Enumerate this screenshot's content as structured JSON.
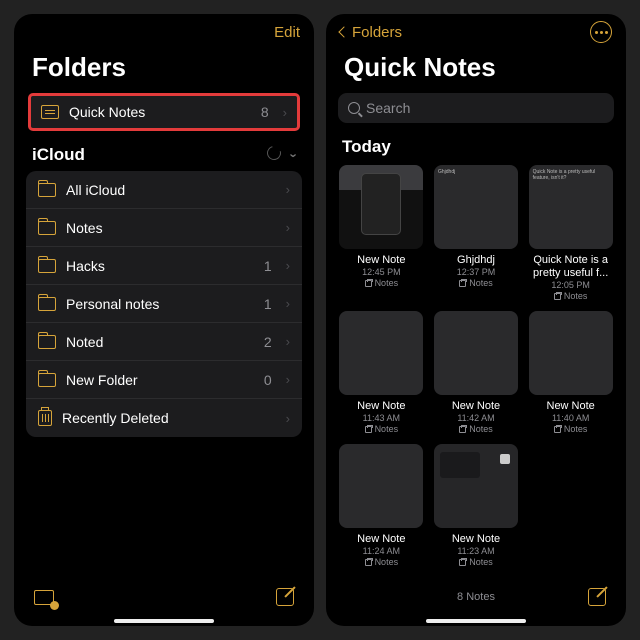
{
  "left": {
    "edit_label": "Edit",
    "title": "Folders",
    "quick_notes": {
      "label": "Quick Notes",
      "count": "8"
    },
    "section_title": "iCloud",
    "rows": [
      {
        "icon": "folder",
        "label": "All iCloud",
        "count": ""
      },
      {
        "icon": "folder",
        "label": "Notes",
        "count": ""
      },
      {
        "icon": "folder",
        "label": "Hacks",
        "count": "1"
      },
      {
        "icon": "folder",
        "label": "Personal notes",
        "count": "1"
      },
      {
        "icon": "folder",
        "label": "Noted",
        "count": "2"
      },
      {
        "icon": "folder",
        "label": "New Folder",
        "count": "0"
      },
      {
        "icon": "trash",
        "label": "Recently Deleted",
        "count": ""
      }
    ]
  },
  "right": {
    "back_label": "Folders",
    "title": "Quick Notes",
    "search_placeholder": "Search",
    "section": "Today",
    "footer_count": "8 Notes",
    "notes_location_label": "Notes",
    "cards": [
      {
        "title": "New Note",
        "time": "12:45 PM",
        "thumb": "img1",
        "thumb_text": ""
      },
      {
        "title": "Ghjdhdj",
        "time": "12:37 PM",
        "thumb": "plain",
        "thumb_text": "Ghjdhdj"
      },
      {
        "title": "Quick Note is a pretty useful f...",
        "time": "12:05 PM",
        "thumb": "plain",
        "thumb_text": "Quick Note is a pretty useful feature, isn't it?",
        "wrap": true
      },
      {
        "title": "New Note",
        "time": "11:43 AM",
        "thumb": "plain",
        "thumb_text": ""
      },
      {
        "title": "New Note",
        "time": "11:42 AM",
        "thumb": "plain",
        "thumb_text": ""
      },
      {
        "title": "New Note",
        "time": "11:40 AM",
        "thumb": "plain",
        "thumb_text": ""
      },
      {
        "title": "New Note",
        "time": "11:24 AM",
        "thumb": "plain",
        "thumb_text": ""
      },
      {
        "title": "New Note",
        "time": "11:23 AM",
        "thumb": "img2",
        "thumb_text": ""
      }
    ]
  }
}
